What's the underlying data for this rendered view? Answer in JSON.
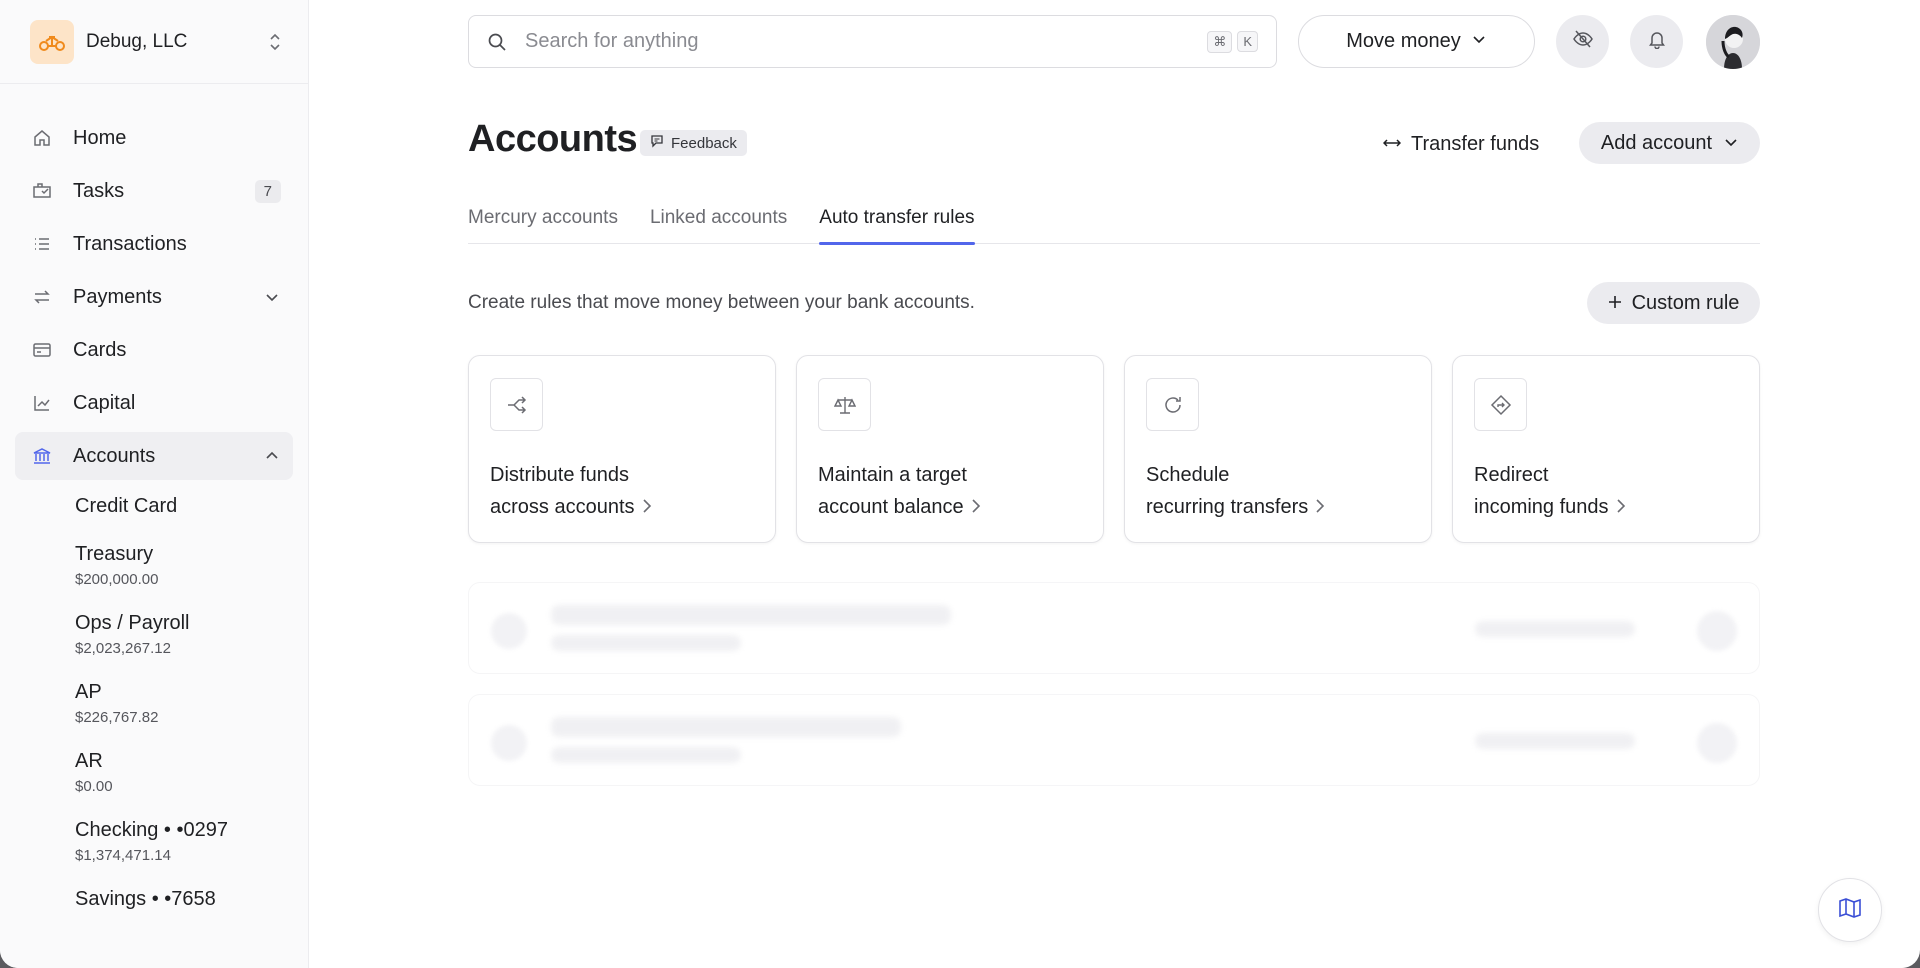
{
  "org": {
    "name": "Debug, LLC"
  },
  "nav": {
    "items": [
      {
        "label": "Home",
        "icon": "home-icon"
      },
      {
        "label": "Tasks",
        "icon": "tasks-icon",
        "badge": "7"
      },
      {
        "label": "Transactions",
        "icon": "list-icon"
      },
      {
        "label": "Payments",
        "icon": "transfer-icon"
      },
      {
        "label": "Cards",
        "icon": "card-icon"
      },
      {
        "label": "Capital",
        "icon": "chart-icon"
      },
      {
        "label": "Accounts",
        "icon": "bank-icon"
      }
    ],
    "accounts": [
      {
        "name": "Credit Card",
        "amount": ""
      },
      {
        "name": "Treasury",
        "amount": "$200,000.00"
      },
      {
        "name": "Ops / Payroll",
        "amount": "$2,023,267.12"
      },
      {
        "name": "AP",
        "amount": "$226,767.82"
      },
      {
        "name": "AR",
        "amount": "$0.00"
      },
      {
        "name": "Checking • •0297",
        "amount": "$1,374,471.14"
      },
      {
        "name": "Savings • •7658",
        "amount": ""
      }
    ]
  },
  "topbar": {
    "search_placeholder": "Search for anything",
    "kbd_cmd": "⌘",
    "kbd_k": "K",
    "move_money": "Move money"
  },
  "header": {
    "title": "Accounts",
    "feedback": "Feedback",
    "transfer_funds": "Transfer funds",
    "add_account": "Add account"
  },
  "tabs": [
    {
      "label": "Mercury accounts"
    },
    {
      "label": "Linked accounts"
    },
    {
      "label": "Auto transfer rules"
    }
  ],
  "rules": {
    "intro": "Create rules that move money between your bank accounts.",
    "custom_rule": "Custom rule",
    "cards": [
      {
        "line1": "Distribute funds",
        "line2": "across accounts",
        "icon": "split-icon"
      },
      {
        "line1": "Maintain a target",
        "line2": "account balance",
        "icon": "scale-icon"
      },
      {
        "line1": "Schedule",
        "line2": "recurring transfers",
        "icon": "refresh-icon"
      },
      {
        "line1": "Redirect",
        "line2": "incoming funds",
        "icon": "redirect-icon"
      }
    ]
  },
  "colors": {
    "accent": "#5266eb",
    "org_logo_bg": "#fde4c8"
  }
}
